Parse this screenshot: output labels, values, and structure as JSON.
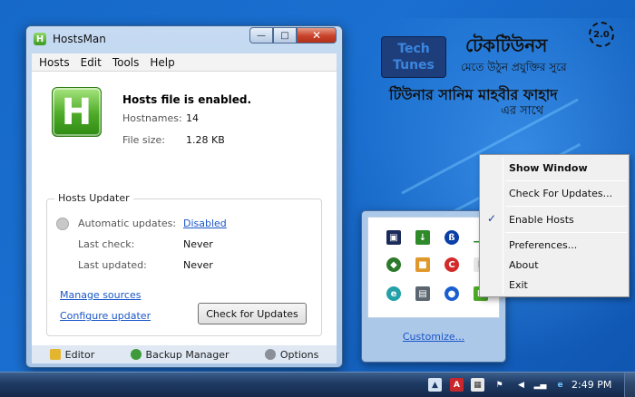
{
  "window": {
    "title": "HostsMan",
    "icon_letter": "H",
    "controls": {
      "minimize": "—",
      "maximize": "□",
      "close": "✕"
    }
  },
  "menu": [
    "Hosts",
    "Edit",
    "Tools",
    "Help"
  ],
  "status": {
    "big_icon_letter": "H",
    "title": "Hosts file is enabled.",
    "hostnames_label": "Hostnames:",
    "hostnames_value": "14",
    "filesize_label": "File size:",
    "filesize_value": "1.28 KB"
  },
  "updater": {
    "title": "Hosts Updater",
    "auto_label": "Automatic updates:",
    "auto_value": "Disabled",
    "last_check_label": "Last check:",
    "last_check_value": "Never",
    "last_updated_label": "Last updated:",
    "last_updated_value": "Never",
    "manage_sources": "Manage sources",
    "configure_updater": "Configure updater",
    "check_button": "Check for Updates"
  },
  "footer": {
    "editor": "Editor",
    "backup_manager": "Backup Manager",
    "options": "Options"
  },
  "logo": {
    "line1": "Tech",
    "line2": "Tunes",
    "bangla_title": "টেকটিউনস",
    "version": "2.0",
    "tagline": "মেতে উঠুন প্রযুক্তির সুরে",
    "author": "টিউনার সানিম মাহবীর ফাহাদ",
    "suffix": "এর সাথে"
  },
  "tray_popup": {
    "customize": "Customize..."
  },
  "context_menu": {
    "items": [
      "Show Window",
      "Check For Updates...",
      "Enable Hosts",
      "Preferences...",
      "About",
      "Exit"
    ],
    "checked_item": "Enable Hosts",
    "check_glyph": "✓"
  },
  "taskbar": {
    "clock": "2:49 PM"
  },
  "colors": {
    "desktop": "#1669c8",
    "accent_green": "#4daa27",
    "link": "#1a56c8",
    "taskbar": "#1e3a63"
  }
}
